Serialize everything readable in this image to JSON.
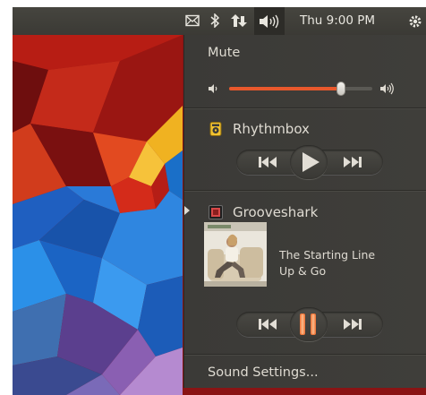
{
  "topbar": {
    "clock": "Thu 9:00 PM",
    "icons": [
      "mail-icon",
      "bluetooth-icon",
      "network-icon",
      "volume-icon",
      "settings-gear-icon"
    ]
  },
  "sound_menu": {
    "mute_label": "Mute",
    "volume_level": 0.78,
    "players": [
      {
        "name": "Rhythmbox",
        "icon": "rhythmbox-icon",
        "state": "stopped",
        "controls": [
          "previous",
          "play",
          "next"
        ]
      },
      {
        "name": "Grooveshark",
        "icon": "grooveshark-icon",
        "state": "playing",
        "active": true,
        "track": {
          "title": "The Starting Line",
          "artist": "Up & Go"
        },
        "controls": [
          "previous",
          "pause",
          "next"
        ]
      }
    ],
    "settings_label": "Sound Settings..."
  },
  "colors": {
    "accent": "#e8582c",
    "menu_bg": "#3c3b37",
    "text": "#dfdbd2"
  }
}
